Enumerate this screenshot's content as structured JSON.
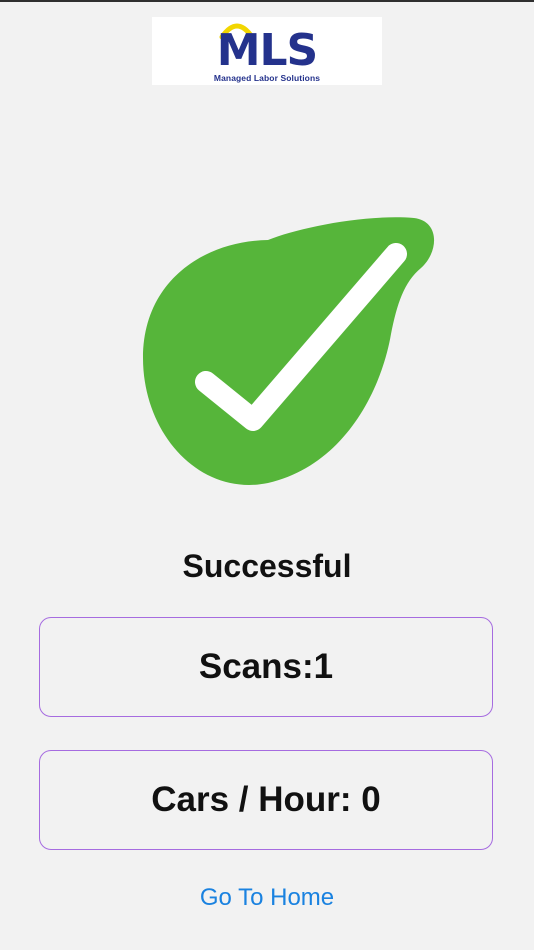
{
  "logo": {
    "text": "MLS",
    "subtitle": "Managed Labor Solutions",
    "accent_color": "#f2d600",
    "text_color": "#24328c"
  },
  "status": {
    "icon": "checkmark-success-icon",
    "icon_color": "#56b53a",
    "text": "Successful"
  },
  "stats": {
    "scans_label": "Scans:1",
    "cars_per_hour_label": "Cars / Hour: 0",
    "border_color": "#a66ce0"
  },
  "navigation": {
    "home_link_label": "Go To Home",
    "link_color": "#1a82e0"
  }
}
